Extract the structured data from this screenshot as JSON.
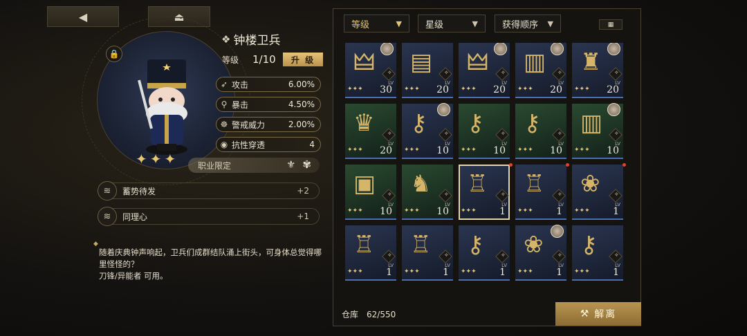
{
  "colors": {
    "accent": "#e2c477",
    "panel": "#161410",
    "rarity_bar": "#4a6fb4"
  },
  "top_buttons": {
    "back_icon": "back-arrow-icon",
    "home_icon": "eject-icon"
  },
  "item": {
    "name": "钟楼卫兵",
    "level_label": "等级",
    "level_value": "1/10",
    "upgrade_label": "升 级",
    "stats": [
      {
        "icon": "attack-icon",
        "name": "攻击",
        "value": "6.00%"
      },
      {
        "icon": "crit-icon",
        "name": "暴击",
        "value": "4.50%"
      },
      {
        "icon": "alert-icon",
        "name": "警戒威力",
        "value": "2.00%"
      },
      {
        "icon": "pierce-icon",
        "name": "抗性穿透",
        "value": "4"
      }
    ],
    "job_label": "职业限定",
    "skills": [
      {
        "name": "蓄势待发",
        "value": "+2"
      },
      {
        "name": "同理心",
        "value": "+1"
      }
    ],
    "description": "随着庆典钟声响起，卫兵们成群结队涌上街头，可身体总觉得哪里怪怪的？",
    "usable_by": "刀锋/异能者 可用。"
  },
  "filters": [
    {
      "label": "等级",
      "active": true
    },
    {
      "label": "星级",
      "active": false
    },
    {
      "label": "获得顺序",
      "active": false
    }
  ],
  "inventory": [
    {
      "art": "winged-helm",
      "bg": "blue",
      "level": "30",
      "avatar": true,
      "selected": false,
      "new": false
    },
    {
      "art": "card",
      "bg": "blue",
      "level": "20",
      "avatar": false,
      "selected": false,
      "new": false
    },
    {
      "art": "winged-helm",
      "bg": "blue",
      "level": "20",
      "avatar": true,
      "selected": false,
      "new": false
    },
    {
      "art": "book",
      "bg": "blue",
      "level": "20",
      "avatar": true,
      "selected": false,
      "new": false
    },
    {
      "art": "bust",
      "bg": "blue",
      "level": "20",
      "avatar": true,
      "selected": false,
      "new": false
    },
    {
      "art": "statue",
      "bg": "green",
      "level": "20",
      "avatar": false,
      "selected": false,
      "new": false
    },
    {
      "art": "key",
      "bg": "blue",
      "level": "10",
      "avatar": true,
      "selected": false,
      "new": false
    },
    {
      "art": "key",
      "bg": "green",
      "level": "10",
      "avatar": false,
      "selected": false,
      "new": false
    },
    {
      "art": "keys",
      "bg": "green",
      "level": "10",
      "avatar": false,
      "selected": false,
      "new": false
    },
    {
      "art": "book",
      "bg": "green",
      "level": "10",
      "avatar": true,
      "selected": false,
      "new": false
    },
    {
      "art": "picture",
      "bg": "green",
      "level": "10",
      "avatar": false,
      "selected": false,
      "new": false
    },
    {
      "art": "wolf",
      "bg": "green",
      "level": "10",
      "avatar": false,
      "selected": false,
      "new": false
    },
    {
      "art": "nutcracker",
      "bg": "blue",
      "level": "1",
      "avatar": false,
      "selected": true,
      "new": true
    },
    {
      "art": "nutcracker",
      "bg": "blue",
      "level": "1",
      "avatar": false,
      "selected": false,
      "new": true
    },
    {
      "art": "cat-card",
      "bg": "blue",
      "level": "1",
      "avatar": false,
      "selected": false,
      "new": true
    },
    {
      "art": "nutcracker",
      "bg": "blue",
      "level": "1",
      "avatar": false,
      "selected": false,
      "new": false
    },
    {
      "art": "nutcracker",
      "bg": "blue",
      "level": "1",
      "avatar": false,
      "selected": false,
      "new": false
    },
    {
      "art": "key",
      "bg": "blue",
      "level": "1",
      "avatar": false,
      "selected": false,
      "new": false
    },
    {
      "art": "cat-card",
      "bg": "blue",
      "level": "1",
      "avatar": true,
      "selected": false,
      "new": false
    },
    {
      "art": "key",
      "bg": "blue",
      "level": "1",
      "avatar": false,
      "selected": false,
      "new": false
    }
  ],
  "lv_label": "LV",
  "footer": {
    "storage_label": "仓库",
    "storage_value": "62/550",
    "dismantle_label": "解离"
  }
}
